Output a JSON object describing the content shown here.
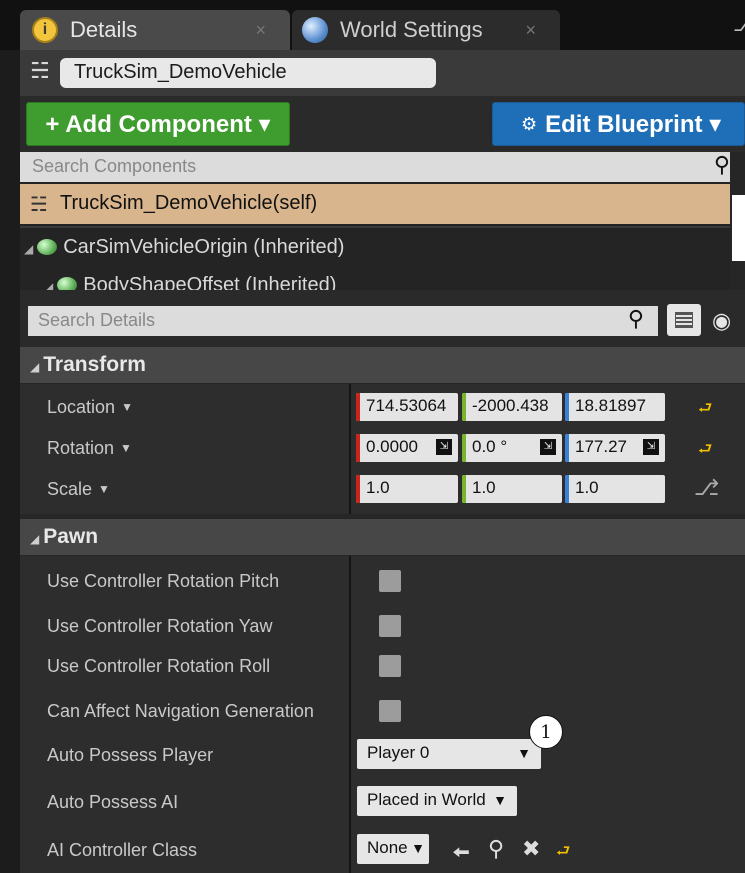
{
  "tabs": [
    {
      "label": "Details",
      "close": "×"
    },
    {
      "label": "World Settings",
      "close": "×"
    }
  ],
  "actor": {
    "name": "TruckSim_DemoVehicle"
  },
  "buttons": {
    "add_component": "+ Add Component ▾",
    "edit_blueprint": "Edit Blueprint ▾"
  },
  "components": {
    "search_placeholder": "Search Components",
    "self_label": "TruckSim_DemoVehicle(self)",
    "items": [
      "CarSimVehicleOrigin (Inherited)",
      "BodyShapeOffset (Inherited)"
    ]
  },
  "details": {
    "search_placeholder": "Search Details"
  },
  "transform": {
    "title": "Transform",
    "location": {
      "label": "Location",
      "x": "714.53064",
      "y": "-2000.438",
      "z": "18.81897"
    },
    "rotation": {
      "label": "Rotation",
      "x": "0.0000",
      "y": "0.0 °",
      "z": "177.27"
    },
    "scale": {
      "label": "Scale",
      "x": "1.0",
      "y": "1.0",
      "z": "1.0"
    }
  },
  "pawn": {
    "title": "Pawn",
    "use_pitch": {
      "label": "Use Controller Rotation Pitch"
    },
    "use_yaw": {
      "label": "Use Controller Rotation Yaw"
    },
    "use_roll": {
      "label": "Use Controller Rotation Roll"
    },
    "can_affect_nav": {
      "label": "Can Affect Navigation Generation"
    },
    "auto_possess_player": {
      "label": "Auto Possess Player",
      "value": "Player 0"
    },
    "auto_possess_ai": {
      "label": "Auto Possess AI",
      "value": "Placed in World"
    },
    "ai_controller_class": {
      "label": "AI Controller Class",
      "value": "None"
    }
  },
  "annotation": {
    "marker": "1"
  },
  "colors": {
    "add_green": "#3f9c2e",
    "edit_blue": "#1f6fb8",
    "self_row": "#d8b58c",
    "x_axis": "#c8261c",
    "y_axis": "#79b52b",
    "z_axis": "#3a7fd8"
  }
}
